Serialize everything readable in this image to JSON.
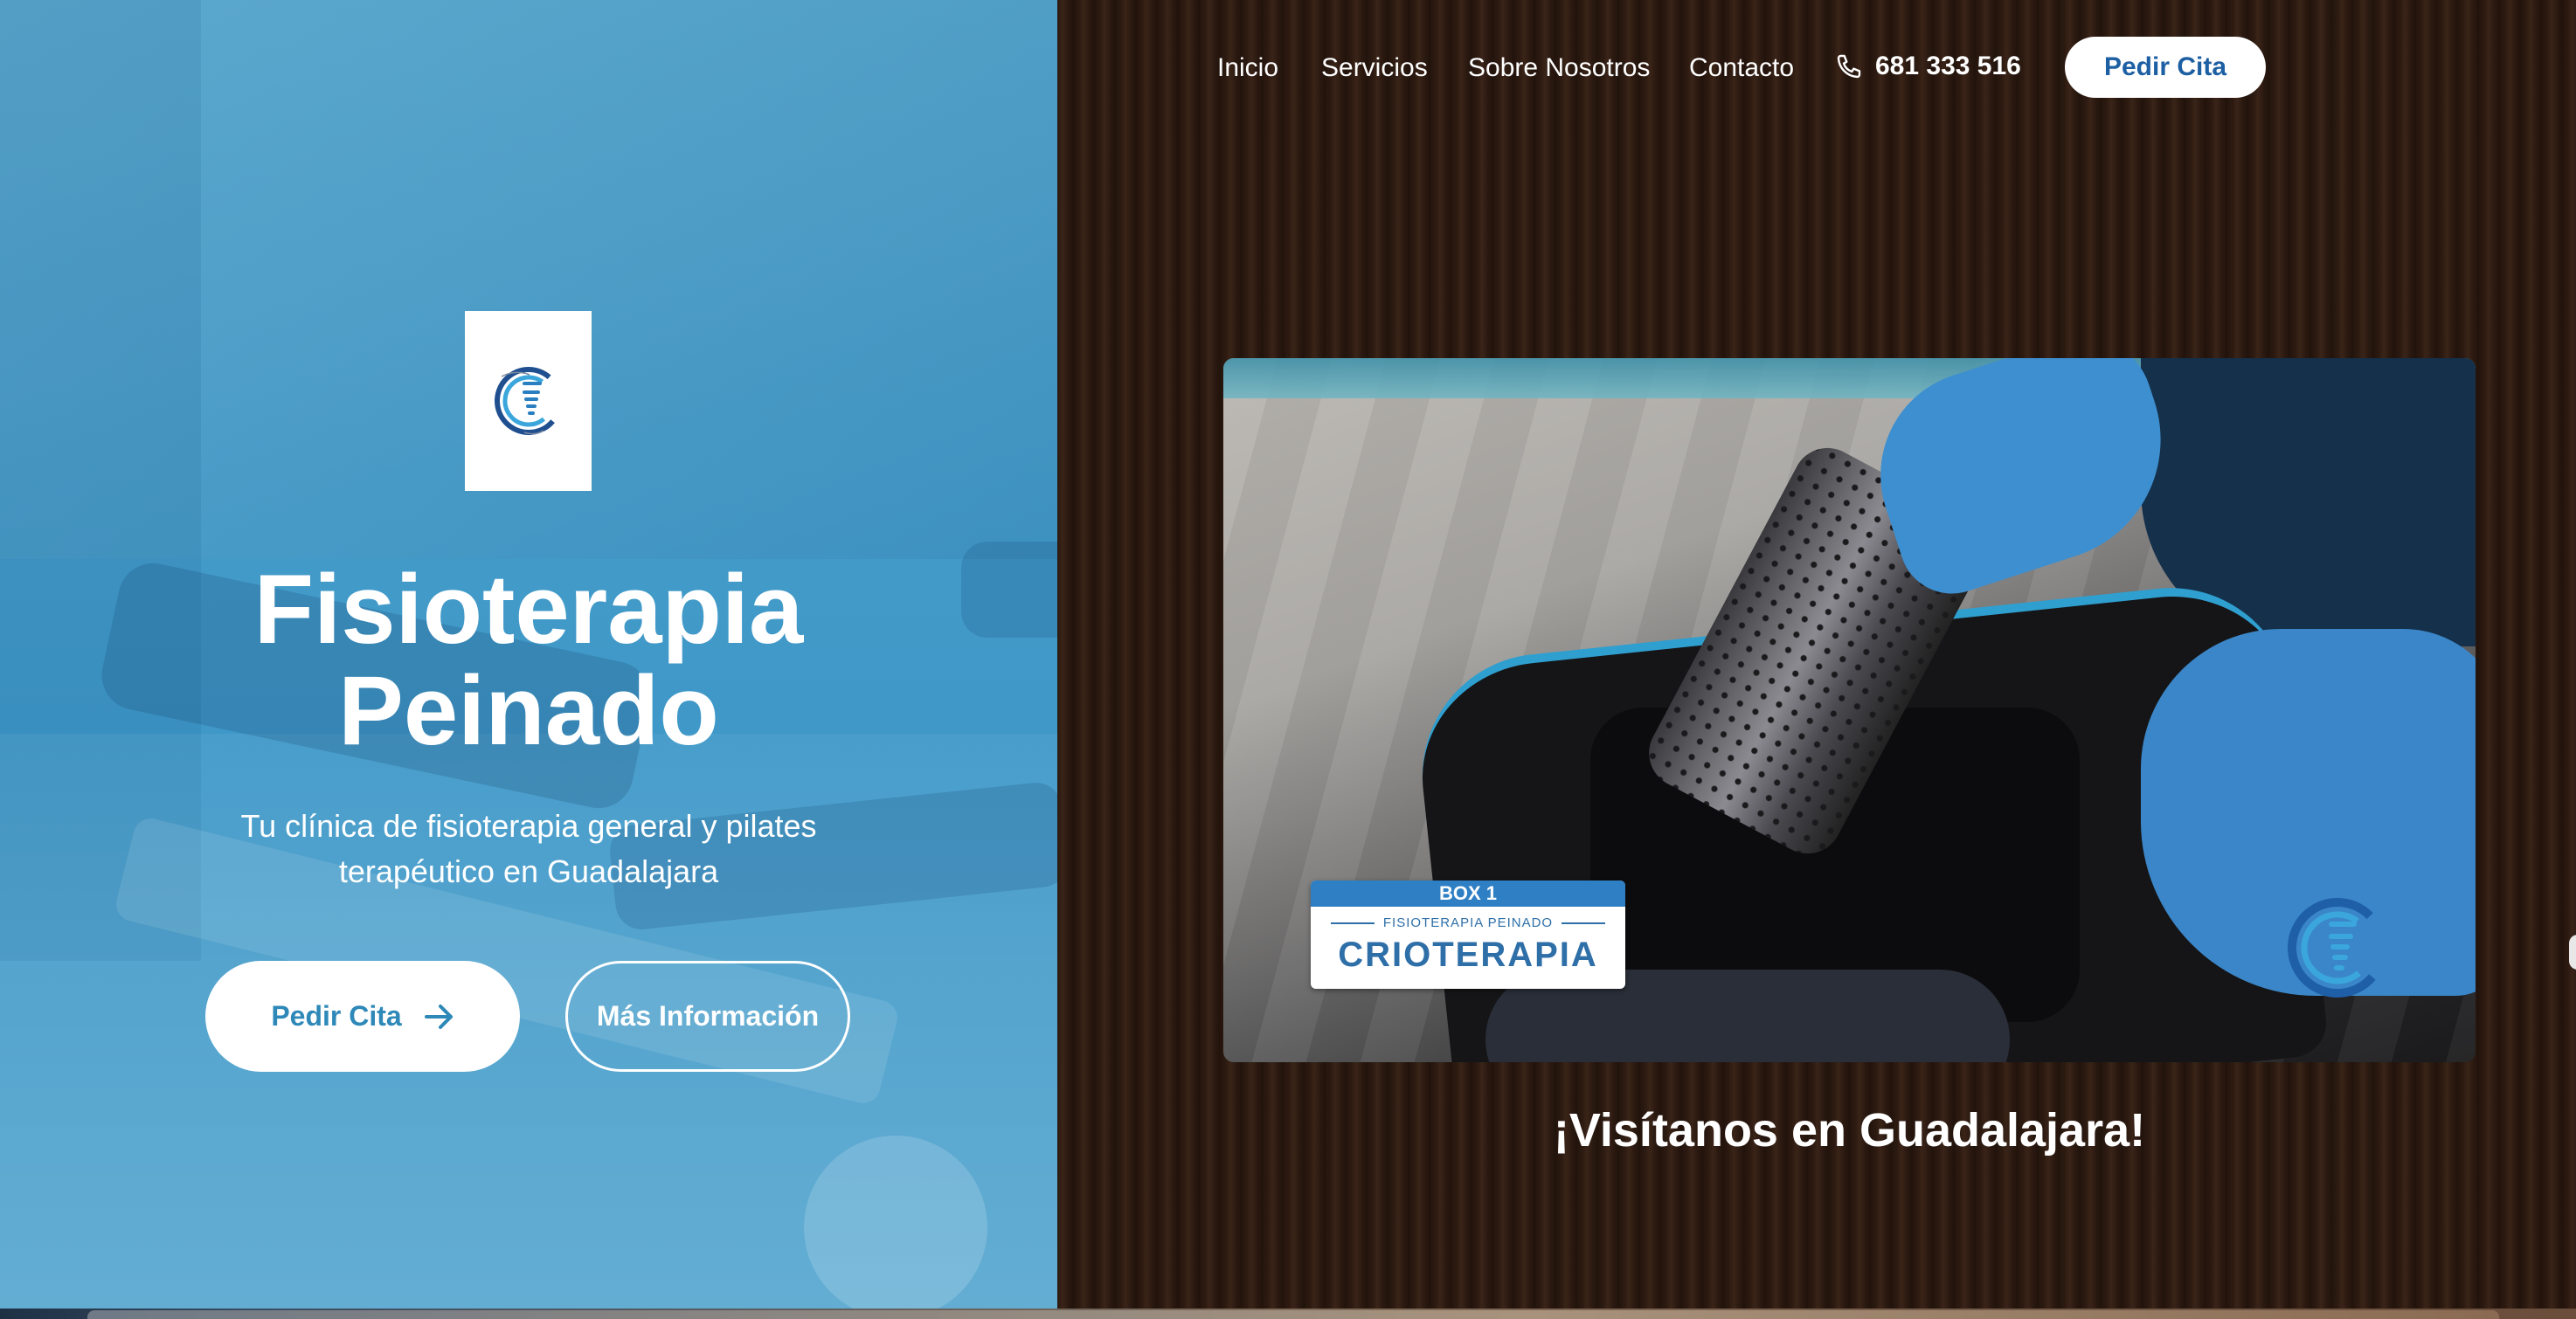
{
  "hero": {
    "title_line1": "Fisioterapia",
    "title_line2": "Peinado",
    "subtitle": "Tu clínica de fisioterapia general y pilates terapéutico en Guadalajara",
    "primary_button": "Pedir Cita",
    "secondary_button": "Más Información",
    "logo_icon": "clinic-logo"
  },
  "nav": {
    "items": [
      "Inicio",
      "Servicios",
      "Sobre Nosotros",
      "Contacto"
    ],
    "phone": "681 333 516",
    "phone_icon": "phone-icon",
    "cta": "Pedir Cita"
  },
  "video": {
    "label_top": "BOX 1",
    "label_mid": "FISIOTERAPIA PEINADO",
    "label_big": "CRIOTERAPIA"
  },
  "visit": {
    "title": "¡Visítanos en Guadalajara!"
  },
  "colors": {
    "hero_blue": "#4aa0cc",
    "button_text_blue": "#2e88b8",
    "nav_cta_text": "#1d5fa3",
    "wood_brown": "#2c1a11"
  }
}
